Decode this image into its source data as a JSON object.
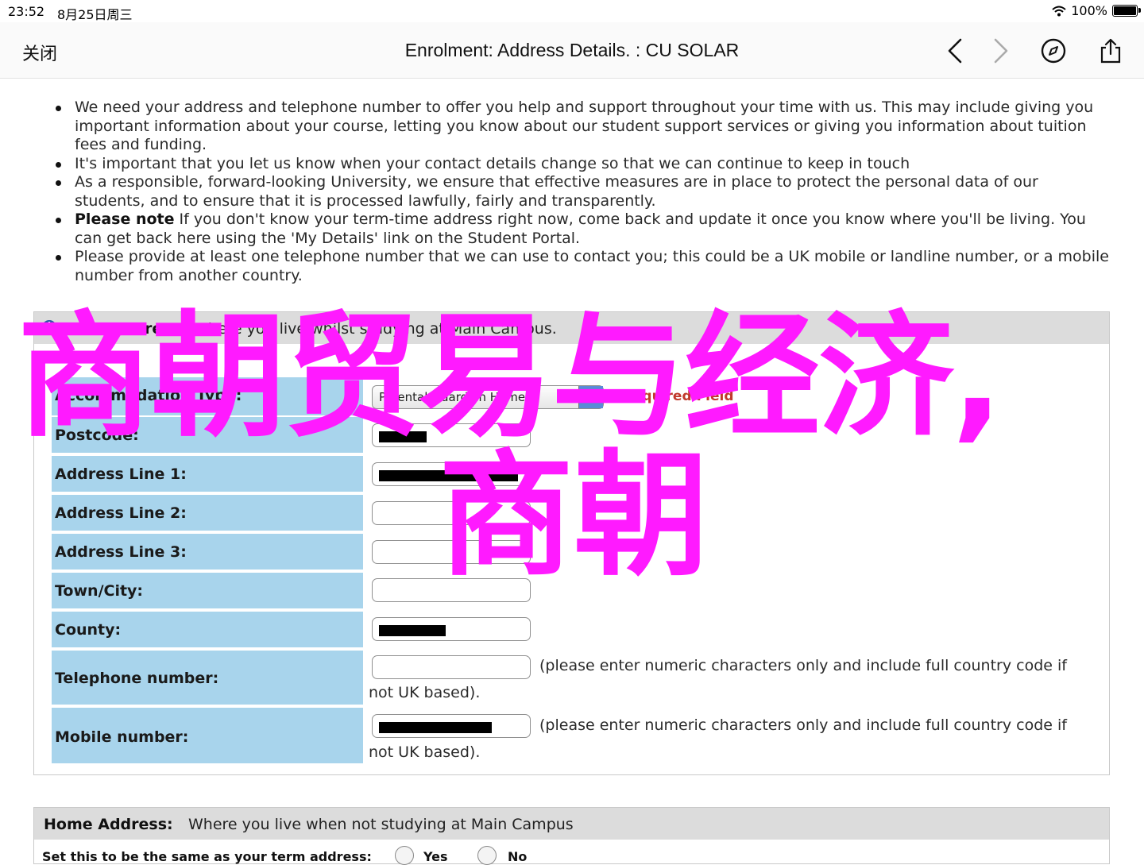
{
  "status_bar": {
    "time": "23:52",
    "date": "8月25日周三",
    "battery": "100%"
  },
  "nav": {
    "close_label": "关闭",
    "title": "Enrolment: Address Details. : CU SOLAR",
    "icons": [
      "chevron-left-icon",
      "chevron-right-icon",
      "compass-icon",
      "share-icon"
    ]
  },
  "intro": {
    "bullets": [
      {
        "bold": "",
        "text": "We need your address and telephone number to offer you help and support throughout your time with us. This may include giving you important information about your course, letting you know about our student support services or giving you information about tuition fees and funding."
      },
      {
        "bold": "",
        "text": "It's important that you let us know when your contact details change so that we can continue to keep in touch"
      },
      {
        "bold": "",
        "text": "As a responsible, forward-looking University, we ensure that effective measures are in place to protect the personal data of our students, and to ensure that it is processed lawfully, fairly and transparently."
      },
      {
        "bold": "Please note",
        "text": " If you don't know your term-time address right now, come back and update it once you know where you'll be living. You can get back here using the 'My Details' link on the Student Portal."
      },
      {
        "bold": "",
        "text": "Please provide at least one telephone number that we can use to contact you; this could be a UK mobile or landline number, or a mobile number from another country."
      }
    ]
  },
  "term_address": {
    "header_label": "Term Address:",
    "header_desc": "Where you live whilst studying at Main Campus.",
    "accommodation_label": "Accommodation Type:",
    "accommodation_value": "Parental/Guardian Home",
    "required_note": "* Required Field",
    "labels": {
      "postcode": "Postcode:",
      "line1": "Address Line 1:",
      "line2": "Address Line 2:",
      "line3": "Address Line 3:",
      "town": "Town/City:",
      "county": "County:",
      "telephone": "Telephone number:",
      "mobile": "Mobile number:"
    },
    "hint_line1": "(please enter numeric characters only and include full country code if",
    "hint_line2": "not UK based)."
  },
  "home_address": {
    "header_label": "Home Address:",
    "header_desc": "Where you live when not studying at Main Campus",
    "same_label": "Set this to be the same as your term address:",
    "yes": "Yes",
    "no": "No"
  },
  "overlay": {
    "line1": "商朝贸易与经济,",
    "line2": "商朝"
  },
  "colors": {
    "row_blue": "#a8d4ec",
    "overlay_magenta": "#ff1aff",
    "header_gray": "#dcdcdc"
  }
}
